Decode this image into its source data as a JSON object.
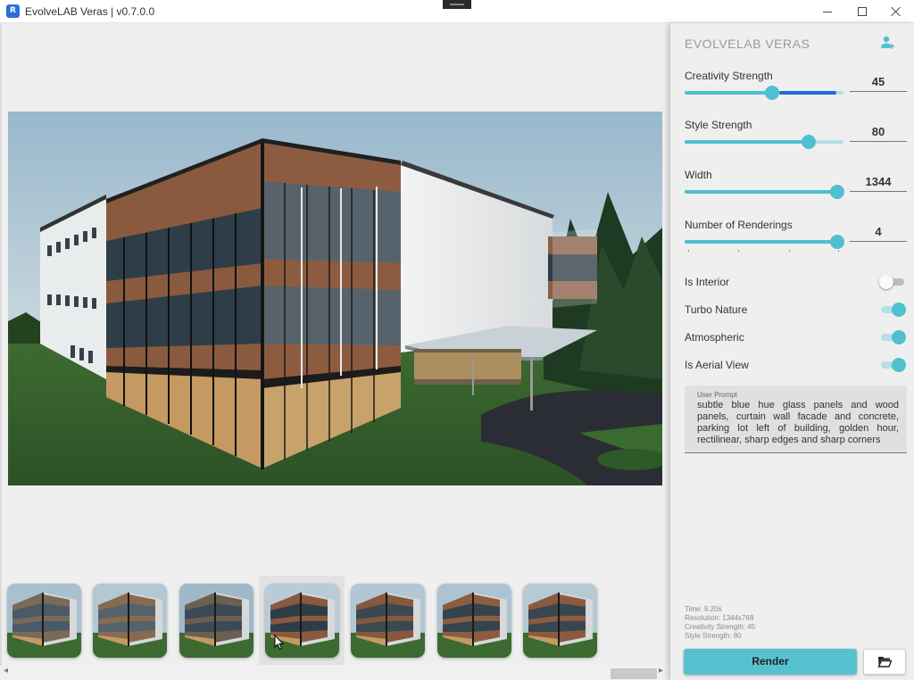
{
  "window": {
    "title": "EvolveLAB Veras | v0.7.0.0",
    "icon_letter": "R"
  },
  "panel": {
    "title": "EVOLVELAB VERAS",
    "user_icon": "account-settings-icon"
  },
  "sliders": {
    "creativity": {
      "label": "Creativity Strength",
      "value": "45",
      "fraction": 0.55
    },
    "style": {
      "label": "Style Strength",
      "value": "80",
      "fraction": 0.78
    },
    "width": {
      "label": "Width",
      "value": "1344",
      "fraction": 0.96
    },
    "renderings": {
      "label": "Number of Renderings",
      "value": "4",
      "fraction": 0.96
    }
  },
  "toggles": {
    "interior": {
      "label": "Is Interior",
      "on": false
    },
    "turbo": {
      "label": "Turbo Nature",
      "on": true
    },
    "atmospheric": {
      "label": "Atmospheric",
      "on": true
    },
    "aerial": {
      "label": "Is Aerial View",
      "on": true
    }
  },
  "prompt": {
    "label": "User Prompt",
    "text": "subtle blue hue glass panels and wood panels, curtain wall facade and concrete, parking lot left of building, golden hour, rectilinear, sharp edges and sharp corners"
  },
  "stats": {
    "time": "Time: 9.20s",
    "resolution": "Resolution: 1344x768",
    "creativity": "Creativity Strength: 45",
    "style": "Style Strength: 80"
  },
  "actions": {
    "render_label": "Render",
    "folder_icon": "folder-open-icon"
  },
  "thumbnails": {
    "count": 7,
    "selected_index": 3
  },
  "colors": {
    "accent": "#4ec0cf",
    "accent_light": "#b5dfe8",
    "progress": "#1f6fd8"
  }
}
